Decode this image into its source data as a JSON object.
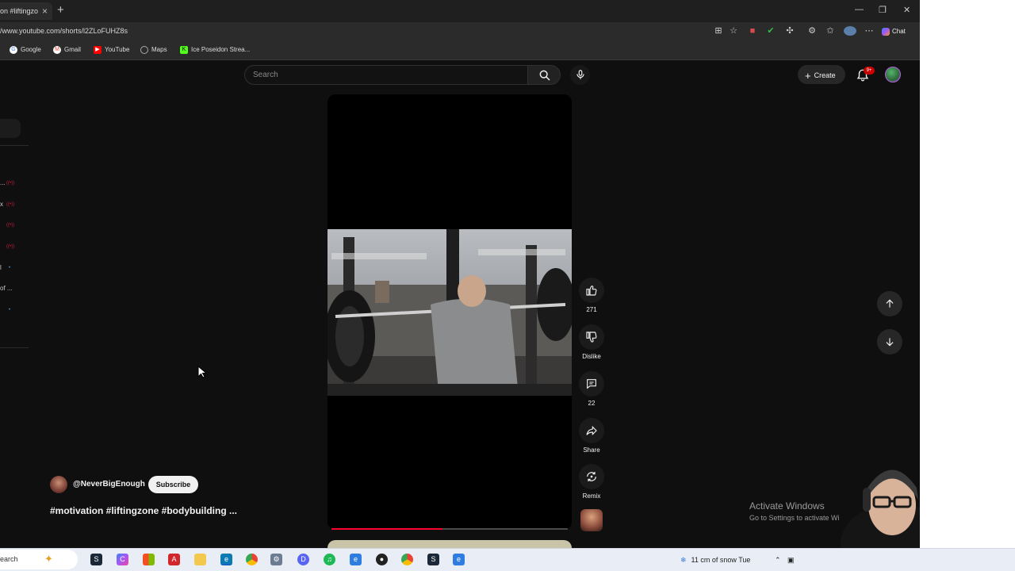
{
  "browser": {
    "tab_title": "on #liftingzo",
    "url": "/www.youtube.com/shorts/l2ZLoFUHZ8s",
    "chat_label": "Chat",
    "bookmarks": [
      {
        "label": "Google",
        "icon": "google-icon",
        "color": "#4285f4"
      },
      {
        "label": "Gmail",
        "icon": "gmail-icon",
        "color": "#ea4335"
      },
      {
        "label": "YouTube",
        "icon": "youtube-icon",
        "color": "#ff0000"
      },
      {
        "label": "Maps",
        "icon": "globe-icon",
        "color": "#aaaaaa"
      },
      {
        "label": "Ice Poseidon Strea...",
        "icon": "kick-icon",
        "color": "#53fc18"
      }
    ]
  },
  "youtube": {
    "search_placeholder": "Search",
    "create_label": "Create",
    "notification_badge": "9+",
    "actions": {
      "like_count": "271",
      "dislike_label": "Dislike",
      "comment_count": "22",
      "share_label": "Share",
      "remix_label": "Remix"
    },
    "channel_name": "@NeverBigEnough",
    "subscribe_label": "Subscribe",
    "caption": "#motivation #liftingzone #bodybuilding ...",
    "progress_fraction": 0.47,
    "sidebar_items": [
      "...",
      "x",
      "",
      "",
      "l",
      "of ..."
    ]
  },
  "overlay": {
    "activate_title": "Activate Windows",
    "activate_sub": "Go to Settings to activate Wi"
  },
  "taskbar": {
    "search_label": "earch",
    "weather": "11 cm of snow Tue"
  }
}
